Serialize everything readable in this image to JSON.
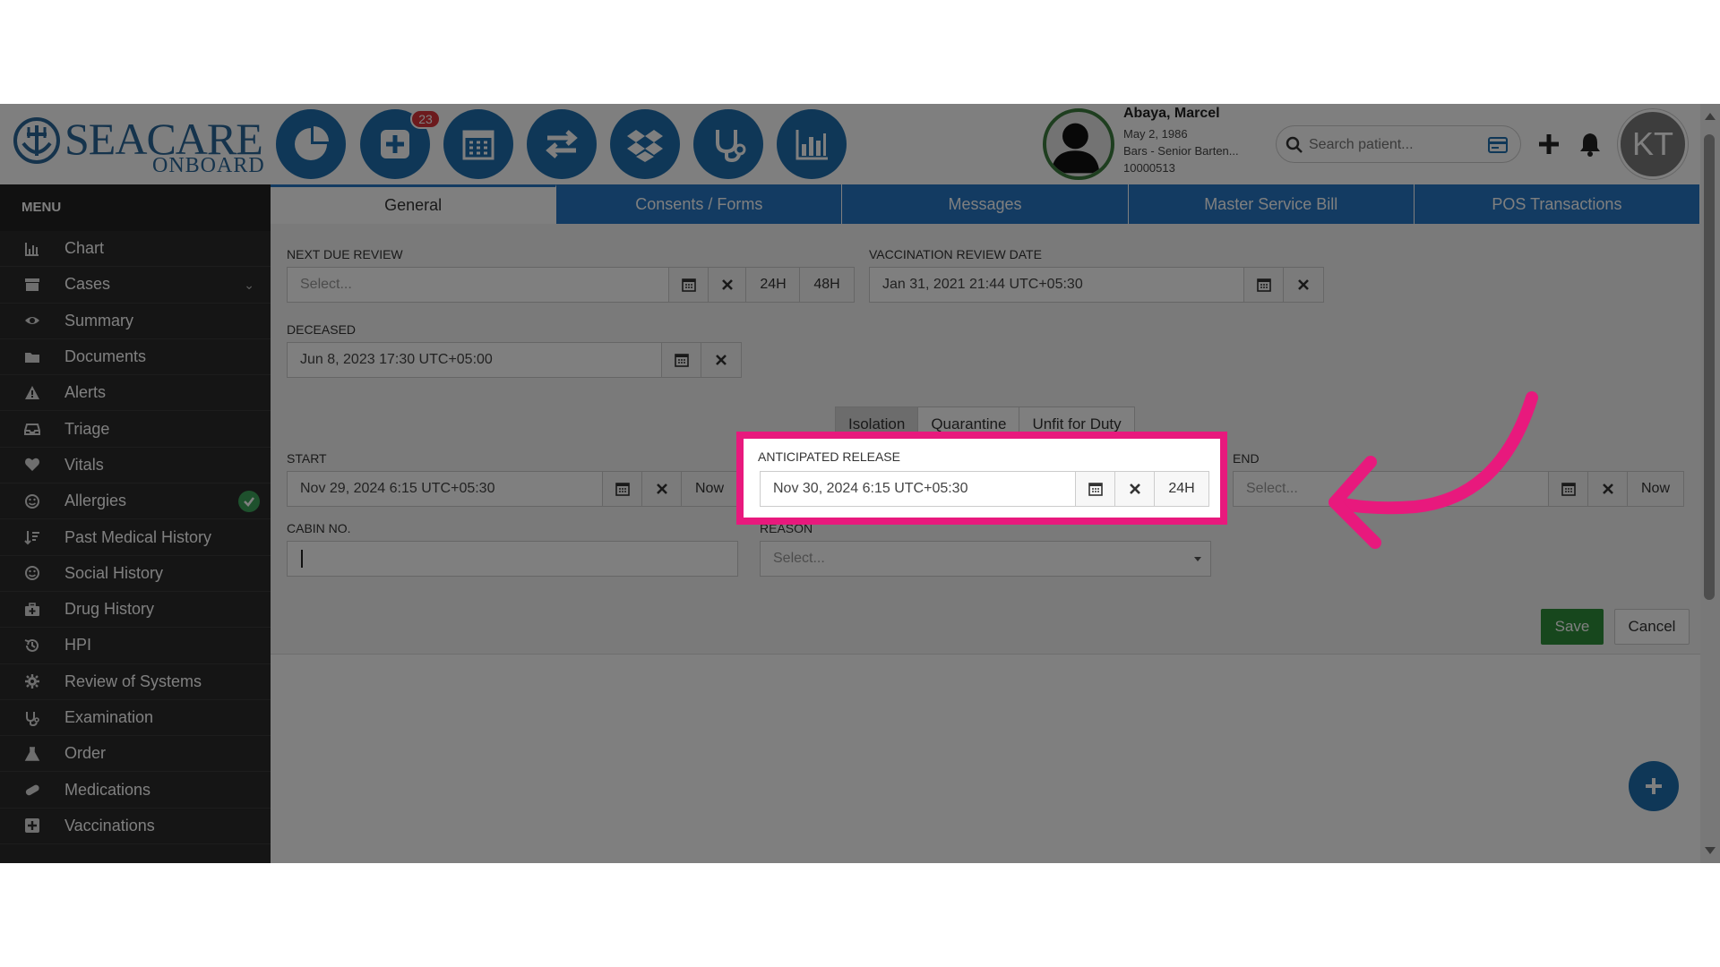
{
  "brand": {
    "name_main": "SEACARE",
    "name_sub": "ONBOARD",
    "color": "#2a6799"
  },
  "header": {
    "notification_count": "23",
    "patient": {
      "name": "Abaya, Marcel",
      "dob": "May 2, 1986",
      "role": "Bars - Senior Barten...",
      "id": "10000513"
    },
    "search": {
      "placeholder": "Search patient..."
    },
    "user_initials": "KT"
  },
  "sidebar": {
    "title": "MENU",
    "items": [
      {
        "label": "Chart",
        "icon": "bar-chart-icon"
      },
      {
        "label": "Cases",
        "icon": "archive-icon",
        "expandable": true
      },
      {
        "label": "Summary",
        "icon": "eye-icon"
      },
      {
        "label": "Documents",
        "icon": "folder-icon"
      },
      {
        "label": "Alerts",
        "icon": "warning-icon"
      },
      {
        "label": "Triage",
        "icon": "inbox-icon"
      },
      {
        "label": "Vitals",
        "icon": "heart-icon"
      },
      {
        "label": "Allergies",
        "icon": "smile-icon",
        "checked": true
      },
      {
        "label": "Past Medical History",
        "icon": "sort-icon"
      },
      {
        "label": "Social History",
        "icon": "smile-icon"
      },
      {
        "label": "Drug History",
        "icon": "medkit-icon"
      },
      {
        "label": "HPI",
        "icon": "history-icon"
      },
      {
        "label": "Review of Systems",
        "icon": "gear-icon"
      },
      {
        "label": "Examination",
        "icon": "stethoscope-icon"
      },
      {
        "label": "Order",
        "icon": "flask-icon"
      },
      {
        "label": "Medications",
        "icon": "pill-icon"
      },
      {
        "label": "Vaccinations",
        "icon": "plus-square-icon"
      }
    ]
  },
  "tabs": [
    {
      "label": "General",
      "active": true
    },
    {
      "label": "Consents / Forms"
    },
    {
      "label": "Messages"
    },
    {
      "label": "Master Service Bill"
    },
    {
      "label": "POS Transactions"
    }
  ],
  "form": {
    "next_due_review": {
      "label": "NEXT DUE REVIEW",
      "placeholder": "Select...",
      "btn_24h": "24H",
      "btn_48h": "48H"
    },
    "vaccination_review_date": {
      "label": "VACCINATION REVIEW DATE",
      "value": "Jan 31, 2021 21:44 UTC+05:30"
    },
    "deceased": {
      "label": "DECEASED",
      "value": "Jun 8, 2023 17:30 UTC+05:00"
    },
    "status_tabs": [
      "Isolation",
      "Quarantine",
      "Unfit for Duty"
    ],
    "start": {
      "label": "START",
      "value": "Nov 29, 2024 6:15 UTC+05:30",
      "btn_now": "Now"
    },
    "anticipated_release": {
      "label": "ANTICIPATED RELEASE",
      "value": "Nov 30, 2024 6:15 UTC+05:30",
      "btn_24h": "24H"
    },
    "end": {
      "label": "END",
      "placeholder": "Select...",
      "btn_now": "Now"
    },
    "cabin_no": {
      "label": "CABIN NO.",
      "value": ""
    },
    "reason": {
      "label": "REASON",
      "placeholder": "Select..."
    },
    "save_label": "Save",
    "cancel_label": "Cancel"
  },
  "colors": {
    "primary": "#1f6fae",
    "tab": "#2677c4",
    "highlight": "#e8197d",
    "save": "#2f8f3a"
  }
}
